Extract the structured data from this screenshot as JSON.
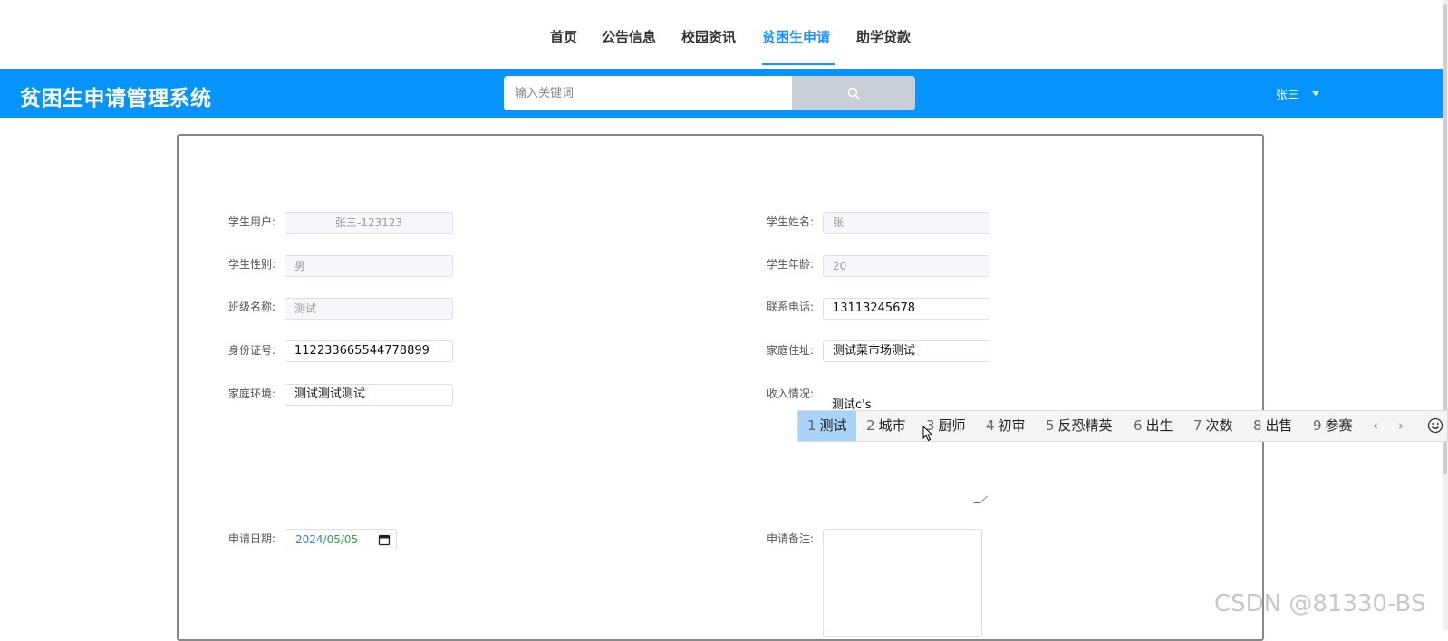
{
  "topnav": {
    "items": [
      {
        "label": "首页",
        "active": false
      },
      {
        "label": "公告信息",
        "active": false
      },
      {
        "label": "校园资讯",
        "active": false
      },
      {
        "label": "贫困生申请",
        "active": true
      },
      {
        "label": "助学贷款",
        "active": false
      }
    ]
  },
  "header": {
    "brand": "贫困生申请管理系统",
    "search_placeholder": "输入关键词",
    "user": "张三"
  },
  "form": {
    "student_user": {
      "label": "学生用户:",
      "value": "张三-123123"
    },
    "student_name": {
      "label": "学生姓名:",
      "value": "张"
    },
    "gender": {
      "label": "学生性别:",
      "value": "男"
    },
    "age": {
      "label": "学生年龄:",
      "value": "20"
    },
    "class_name": {
      "label": "班级名称:",
      "value": "测试"
    },
    "phone": {
      "label": "联系电话:",
      "value": "13113245678"
    },
    "id_number": {
      "label": "身份证号:",
      "value": "112233665544778899"
    },
    "address": {
      "label": "家庭住址:",
      "value": "测试菜市场测试"
    },
    "family_env": {
      "label": "家庭环境:",
      "value": "测试测试测试"
    },
    "income": {
      "label": "收入情况:",
      "value": "测试c's"
    },
    "apply_date": {
      "label": "申请日期:",
      "year": "2024",
      "sep": "/",
      "month": "05",
      "day": "05"
    },
    "remark": {
      "label": "申请备注:",
      "value": ""
    }
  },
  "ime": {
    "candidates": [
      {
        "n": "1",
        "text": "测试",
        "selected": true
      },
      {
        "n": "2",
        "text": "城市",
        "selected": false
      },
      {
        "n": "3",
        "text": "厨师",
        "selected": false
      },
      {
        "n": "4",
        "text": "初审",
        "selected": false
      },
      {
        "n": "5",
        "text": "反恐精英",
        "selected": false
      },
      {
        "n": "6",
        "text": "出生",
        "selected": false
      },
      {
        "n": "7",
        "text": "次数",
        "selected": false
      },
      {
        "n": "8",
        "text": "出售",
        "selected": false
      },
      {
        "n": "9",
        "text": "参赛",
        "selected": false
      }
    ],
    "prev": "‹",
    "next": "›",
    "emoji_icon": "smiley-icon"
  },
  "watermark": "CSDN @81330-BS",
  "colors": {
    "accent": "#1e90ff",
    "header_bg": "#0693fb",
    "ime_selected": "#a9d3f7"
  }
}
